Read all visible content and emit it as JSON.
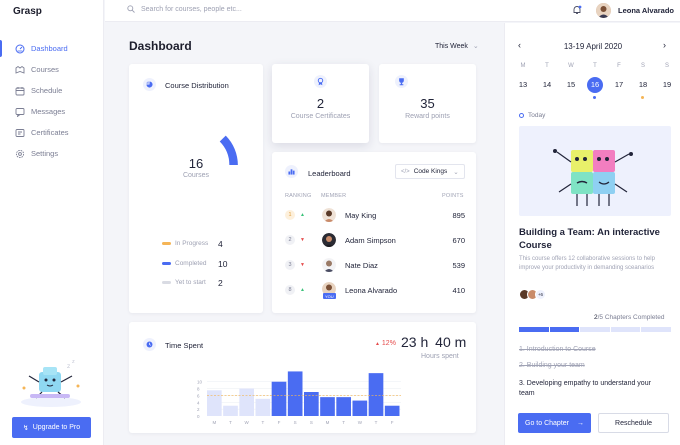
{
  "app": {
    "logo": "Grasp"
  },
  "nav": [
    {
      "label": "Dashboard",
      "icon": "dashboard-icon"
    },
    {
      "label": "Courses",
      "icon": "courses-icon"
    },
    {
      "label": "Schedule",
      "icon": "calendar-icon"
    },
    {
      "label": "Messages",
      "icon": "messages-icon"
    },
    {
      "label": "Certificates",
      "icon": "certificate-icon"
    },
    {
      "label": "Settings",
      "icon": "gear-icon"
    }
  ],
  "promo": {
    "button": "Upgrade to Pro"
  },
  "topbar": {
    "search_placeholder": "Search for courses, people etc...",
    "user_name": "Leona Alvarado"
  },
  "header": {
    "title": "Dashboard",
    "period": "This Week"
  },
  "course_distribution": {
    "title": "Course Distribution",
    "total": "16",
    "total_label": "Courses",
    "legend": [
      {
        "label": "In Progress",
        "value": "4",
        "color": "#f5b556"
      },
      {
        "label": "Completed",
        "value": "10",
        "color": "#4a6cf2"
      },
      {
        "label": "Yet to start",
        "value": "2",
        "color": "#d9dbe3"
      }
    ]
  },
  "certificates": {
    "value": "2",
    "label": "Course Certificates"
  },
  "rewards": {
    "value": "35",
    "label": "Reward points"
  },
  "leaderboard": {
    "title": "Leaderboard",
    "filter": "Code Kings",
    "columns": {
      "ranking": "RANKING",
      "member": "MEMBER",
      "points": "POINTS"
    },
    "rows": [
      {
        "rank": "1",
        "name": "May King",
        "points": "895",
        "trend": "up"
      },
      {
        "rank": "2",
        "name": "Adam Simpson",
        "points": "670",
        "trend": "down"
      },
      {
        "rank": "3",
        "name": "Nate Diaz",
        "points": "539",
        "trend": "down"
      },
      {
        "rank": "8",
        "name": "Leona Alvarado",
        "points": "410",
        "trend": "up",
        "badge": "YOU"
      }
    ]
  },
  "time_spent": {
    "title": "Time Spent",
    "change": "12%",
    "hours": "23",
    "hours_unit": "h",
    "minutes": "40",
    "minutes_unit": "m",
    "caption": "Hours spent"
  },
  "chart_data": {
    "type": "bar",
    "categories": [
      "M",
      "T",
      "W",
      "T",
      "F",
      "S",
      "S",
      "M",
      "T",
      "W",
      "T",
      "F"
    ],
    "values": [
      7.5,
      3,
      8,
      5,
      10,
      13,
      7,
      5.5,
      5.5,
      4.5,
      12.5,
      3
    ],
    "ylim": [
      0,
      14
    ],
    "yticks": [
      0,
      2,
      4,
      6,
      8,
      10
    ],
    "highlight_from": 4,
    "colors": {
      "past": "#dfe4fb",
      "current": "#4a6cf2"
    }
  },
  "calendar": {
    "range": "13-19 April 2020",
    "weekdays": [
      "M",
      "T",
      "W",
      "T",
      "F",
      "S",
      "S"
    ],
    "days": [
      "13",
      "14",
      "15",
      "16",
      "17",
      "18",
      "19"
    ],
    "selected": "16",
    "today_label": "Today"
  },
  "event": {
    "title": "Building a Team: An interactive Course",
    "description": "This course offers 12 collaborative sessions to help improve your productivity in demanding sceanarios",
    "extra_members": "+6",
    "chapters_done": "2",
    "chapters_total": "/5 Chapters Completed",
    "progress": 0.4,
    "chapters": [
      {
        "label": "1. Introduction to Course",
        "done": true
      },
      {
        "label": "2. Building your team",
        "done": true
      },
      {
        "label": "3. Developing empathy to  understand your team",
        "done": false
      }
    ],
    "go_button": "Go to Chapter",
    "reschedule_button": "Reschedule"
  },
  "colors": {
    "accent": "#4a6cf2",
    "orange": "#f5b556",
    "danger": "#e54b4b",
    "success": "#3bc27a"
  }
}
